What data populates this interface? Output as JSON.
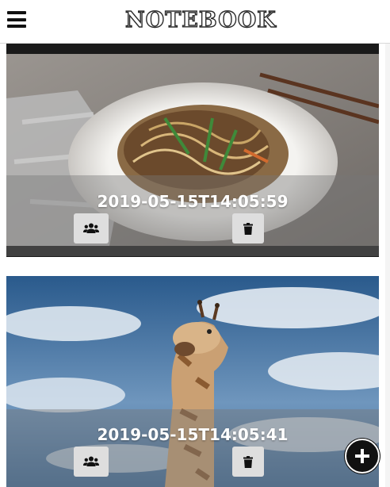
{
  "header": {
    "logo_text": "NOTEBOOK",
    "menu_icon": "hamburger-menu-icon"
  },
  "notes": [
    {
      "timestamp": "2019-05-15T14:05:59",
      "photo": "noodle-dish-photo",
      "share_icon": "users-icon",
      "delete_icon": "trash-icon"
    },
    {
      "timestamp": "2019-05-15T14:05:41",
      "photo": "giraffe-photo",
      "share_icon": "users-icon",
      "delete_icon": "trash-icon"
    }
  ],
  "fab": {
    "icon": "plus-circle-icon"
  },
  "colors": {
    "header_bg": "#ffffff",
    "button_bg": "#dedede",
    "overlay": "rgba(120,120,120,0.42)",
    "timestamp_text": "#ffffff",
    "fab_bg": "#111111"
  }
}
